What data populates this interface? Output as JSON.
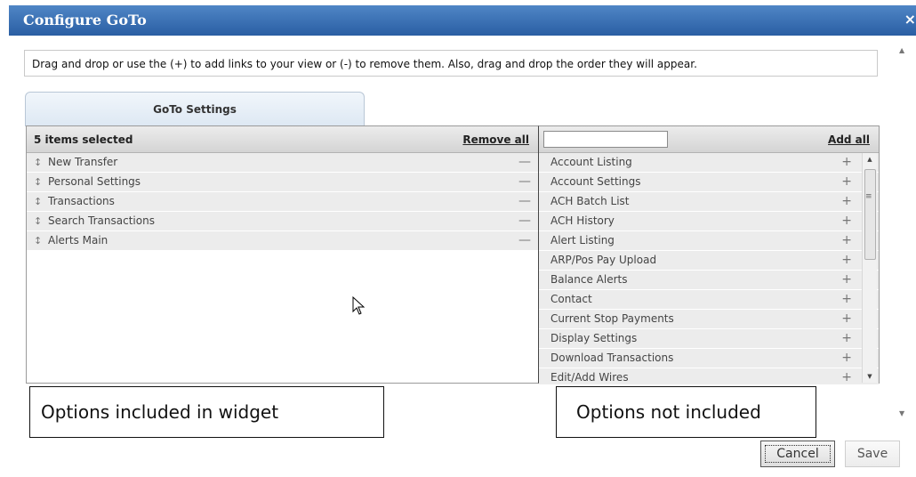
{
  "dialog": {
    "title": "Configure GoTo",
    "close_glyph": "×"
  },
  "instructions": "Drag and drop or use the (+) to add links to your view or (-) to remove them. Also, drag and drop the order they will appear.",
  "tab": {
    "label": "GoTo Settings"
  },
  "selected": {
    "header": "5 items selected",
    "remove_all": "Remove all",
    "items": [
      {
        "label": "New Transfer",
        "grip": "↕",
        "op": "—"
      },
      {
        "label": "Personal Settings",
        "grip": "↕",
        "op": "—"
      },
      {
        "label": "Transactions",
        "grip": "↕",
        "op": "—"
      },
      {
        "label": "Search Transactions",
        "grip": "↕",
        "op": "—"
      },
      {
        "label": "Alerts Main",
        "grip": "↕",
        "op": "—"
      }
    ]
  },
  "available": {
    "search_value": "",
    "add_all": "Add all",
    "items": [
      {
        "label": "Account Listing",
        "op": "+"
      },
      {
        "label": "Account Settings",
        "op": "+"
      },
      {
        "label": "ACH Batch List",
        "op": "+"
      },
      {
        "label": "ACH History",
        "op": "+"
      },
      {
        "label": "Alert Listing",
        "op": "+"
      },
      {
        "label": "ARP/Pos Pay Upload",
        "op": "+"
      },
      {
        "label": "Balance Alerts",
        "op": "+"
      },
      {
        "label": "Contact",
        "op": "+"
      },
      {
        "label": "Current Stop Payments",
        "op": "+"
      },
      {
        "label": "Display Settings",
        "op": "+"
      },
      {
        "label": "Download Transactions",
        "op": "+"
      },
      {
        "label": "Edit/Add Wires",
        "op": "+"
      }
    ]
  },
  "callouts": {
    "left": "Options included in widget",
    "right": "Options not included"
  },
  "buttons": {
    "cancel": "Cancel",
    "save": "Save"
  },
  "icons": {
    "cursor": "mouse-pointer-icon",
    "grip": "drag-handle-icon"
  },
  "colors": {
    "title_bar": "#3b70b3",
    "row_bg": "#ececec"
  }
}
